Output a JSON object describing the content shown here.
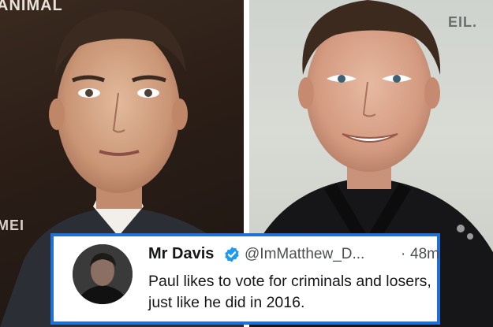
{
  "left_photo": {
    "backdrop_top": "ANIMAL",
    "backdrop_bottom": "MEI"
  },
  "right_photo": {
    "backdrop_top": "EIL."
  },
  "tweet": {
    "name": "Mr Davis",
    "handle": "@ImMatthew_D...",
    "dot": "·",
    "time": "48m",
    "text": "Paul likes to vote for criminals and losers, just like he did in 2016.",
    "icons": {
      "verified": "verified-badge-icon"
    },
    "colors": {
      "border": "#1f6fd6",
      "verified": "#1d9bf0"
    }
  }
}
